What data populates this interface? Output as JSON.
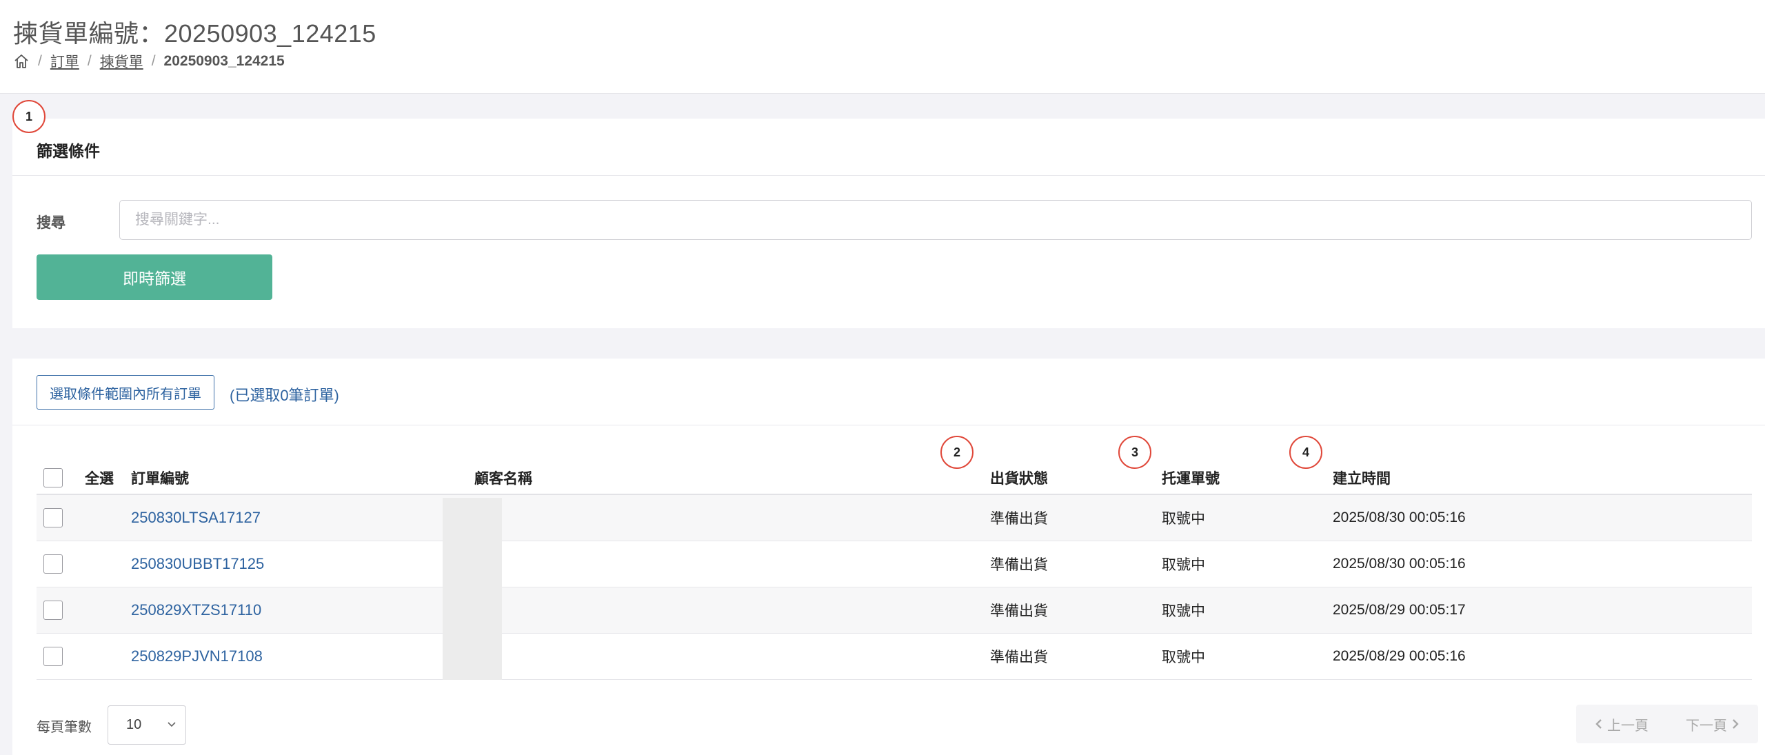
{
  "header": {
    "title": "揀貨單編號：20250903_124215",
    "breadcrumb": [
      "訂單",
      "揀貨單"
    ],
    "breadcrumb_current": "20250903_124215"
  },
  "markers": [
    "1",
    "2",
    "3",
    "4"
  ],
  "filter": {
    "title": "篩選條件",
    "search_label": "搜尋",
    "search_placeholder": "搜尋關鍵字...",
    "search_value": "",
    "button": "即時篩選"
  },
  "list": {
    "select_all_button": "選取條件範圍內所有訂單",
    "selected_count": "(已選取0筆訂單)",
    "columns": {
      "select_all": "全選",
      "order_no": "訂單編號",
      "customer": "顧客名稱",
      "ship_status": "出貨狀態",
      "tracking": "托運單號",
      "created": "建立時間"
    },
    "rows": [
      {
        "order_no": "250830LTSA17127",
        "customer": "",
        "ship_status": "準備出貨",
        "tracking": "取號中",
        "created": "2025/08/30 00:05:16"
      },
      {
        "order_no": "250830UBBT17125",
        "customer": "",
        "ship_status": "準備出貨",
        "tracking": "取號中",
        "created": "2025/08/30 00:05:16"
      },
      {
        "order_no": "250829XTZS17110",
        "customer": "",
        "ship_status": "準備出貨",
        "tracking": "取號中",
        "created": "2025/08/29 00:05:17"
      },
      {
        "order_no": "250829PJVN17108",
        "customer": "",
        "ship_status": "準備出貨",
        "tracking": "取號中",
        "created": "2025/08/29 00:05:16"
      }
    ]
  },
  "pagination": {
    "page_size_label": "每頁筆數",
    "page_size": "10",
    "prev": "上一頁",
    "next": "下一頁"
  },
  "colors": {
    "accent": "#52b396",
    "link": "#2e63a0",
    "marker": "#e0483a"
  },
  "icons": [
    "home-icon",
    "chevron-down-icon",
    "chevron-left-icon",
    "chevron-right-icon"
  ]
}
